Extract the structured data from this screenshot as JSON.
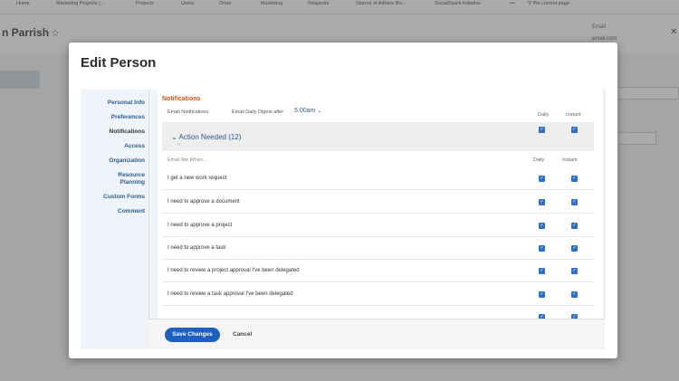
{
  "topnav": {
    "items": [
      "Home",
      "Marketing Projects (...",
      "Projects",
      "Users",
      "Orion",
      "Marketing",
      "Requests",
      "Storms of Adhere Bo...",
      "SocialSpark Initiative"
    ],
    "more": "•••",
    "pin_label": "Pin current page"
  },
  "background": {
    "person_name": "n Parrish",
    "star": "☆",
    "email_label": "Email",
    "email_value": "email.com",
    "close": "✕"
  },
  "modal": {
    "title": "Edit Person",
    "sidebar": [
      {
        "label": "Personal Info"
      },
      {
        "label": "Preferences"
      },
      {
        "label": "Notifications"
      },
      {
        "label": "Access"
      },
      {
        "label": "Organization"
      },
      {
        "label": "Resource Planning"
      },
      {
        "label": "Custom Forms"
      },
      {
        "label": "Comment"
      }
    ],
    "section_title": "Notifications",
    "email_notifications_label": "Email Notifications",
    "digest_label": "Email Daily Digest after",
    "digest_value": "5:00am",
    "col_daily": "Daily",
    "col_instant": "Instant",
    "group_title": "Action Needed (12)",
    "email_when": "Email Me When...",
    "rows": [
      {
        "label": "I get a new work request"
      },
      {
        "label": "I need to approve a document"
      },
      {
        "label": "I need to approve a project"
      },
      {
        "label": "I need to approve a task"
      },
      {
        "label": "I need to review a project approval I've been delegated"
      },
      {
        "label": "I need to review a task approval I've been delegated"
      },
      {
        "label": ""
      }
    ],
    "save_label": "Save Changes",
    "cancel_label": "Cancel"
  },
  "colors": {
    "accent": "#1f5fbf",
    "section": "#c75a11",
    "link": "#2d5b8c"
  }
}
